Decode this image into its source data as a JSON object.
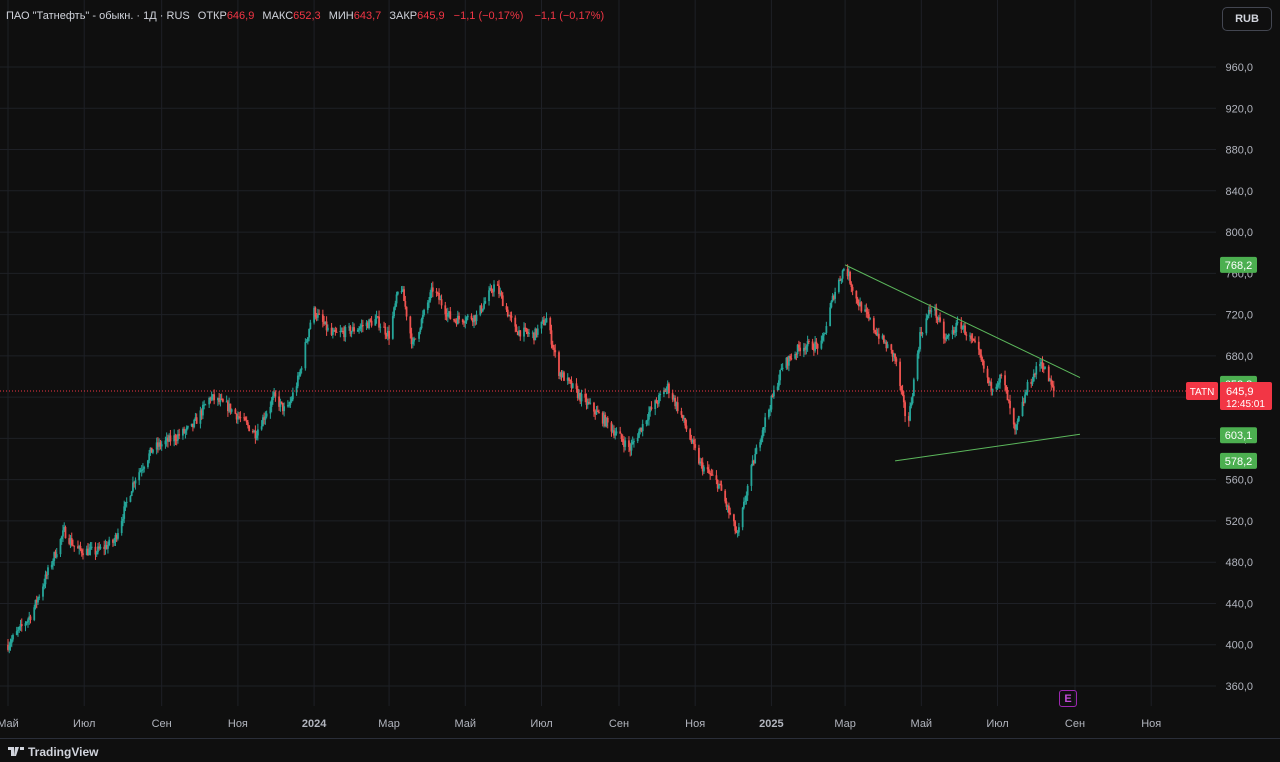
{
  "legend": {
    "title": "ПАО \"Татнефть\" - обыкн. · 1Д · RUS",
    "open_label": "ОТКР",
    "open_value": "646,9",
    "high_label": "МАКС",
    "high_value": "652,3",
    "low_label": "МИН",
    "low_value": "643,7",
    "close_label": "ЗАКР",
    "close_value": "645,9",
    "change": "−1,1 (−0,17%)",
    "change2": "−1,1 (−0,17%)"
  },
  "currency": "RUB",
  "branding": "TradingView",
  "earnings_icon": "E",
  "colors": {
    "background": "#0f0f0f",
    "up": "#26a69a",
    "down": "#ef5350",
    "trendline": "#5cb85c",
    "price_badge": "#f23645",
    "level_badge": "#4caf50",
    "grid": "#1e2026"
  },
  "chart_data": {
    "type": "candlestick",
    "symbol": "TATN",
    "y_ticks": [
      "360,0",
      "400,0",
      "440,0",
      "480,0",
      "520,0",
      "560,0",
      "600,0",
      "640,0",
      "680,0",
      "720,0",
      "760,0",
      "800,0",
      "840,0",
      "880,0",
      "920,0",
      "960,0"
    ],
    "x_ticks": [
      {
        "label": "Май",
        "date": "2023-05-01"
      },
      {
        "label": "Июл",
        "date": "2023-07-01"
      },
      {
        "label": "Сен",
        "date": "2023-09-01"
      },
      {
        "label": "Ноя",
        "date": "2023-11-01"
      },
      {
        "label": "2024",
        "date": "2024-01-01",
        "bold": true
      },
      {
        "label": "Мар",
        "date": "2024-03-01"
      },
      {
        "label": "Май",
        "date": "2024-05-01"
      },
      {
        "label": "Июл",
        "date": "2024-07-01"
      },
      {
        "label": "Сен",
        "date": "2024-09-01"
      },
      {
        "label": "Ноя",
        "date": "2024-11-01"
      },
      {
        "label": "2025",
        "date": "2025-01-01",
        "bold": true
      },
      {
        "label": "Мар",
        "date": "2025-03-01"
      },
      {
        "label": "Май",
        "date": "2025-05-01"
      },
      {
        "label": "Июл",
        "date": "2025-07-01"
      },
      {
        "label": "Сен",
        "date": "2025-09-01"
      },
      {
        "label": "Ноя",
        "date": "2025-11-01"
      }
    ],
    "price_path": [
      [
        "2023-05-01",
        400
      ],
      [
        "2023-05-20",
        430
      ],
      [
        "2023-06-05",
        480
      ],
      [
        "2023-06-15",
        510
      ],
      [
        "2023-06-25",
        492
      ],
      [
        "2023-07-10",
        490
      ],
      [
        "2023-07-25",
        500
      ],
      [
        "2023-08-10",
        560
      ],
      [
        "2023-08-25",
        590
      ],
      [
        "2023-09-10",
        600
      ],
      [
        "2023-09-25",
        610
      ],
      [
        "2023-10-10",
        640
      ],
      [
        "2023-10-25",
        630
      ],
      [
        "2023-11-15",
        605
      ],
      [
        "2023-11-30",
        640
      ],
      [
        "2023-12-10",
        625
      ],
      [
        "2023-12-20",
        660
      ],
      [
        "2023-12-31",
        725
      ],
      [
        "2024-01-15",
        700
      ],
      [
        "2024-02-01",
        705
      ],
      [
        "2024-02-20",
        715
      ],
      [
        "2024-03-01",
        700
      ],
      [
        "2024-03-10",
        752
      ],
      [
        "2024-03-20",
        690
      ],
      [
        "2024-04-05",
        745
      ],
      [
        "2024-04-20",
        715
      ],
      [
        "2024-05-10",
        718
      ],
      [
        "2024-05-25",
        750
      ],
      [
        "2024-06-10",
        705
      ],
      [
        "2024-06-25",
        700
      ],
      [
        "2024-07-05",
        716
      ],
      [
        "2024-07-15",
        665
      ],
      [
        "2024-08-01",
        640
      ],
      [
        "2024-08-20",
        618
      ],
      [
        "2024-09-10",
        590
      ],
      [
        "2024-09-25",
        625
      ],
      [
        "2024-10-10",
        650
      ],
      [
        "2024-10-20",
        625
      ],
      [
        "2024-11-05",
        575
      ],
      [
        "2024-11-20",
        555
      ],
      [
        "2024-12-05",
        505
      ],
      [
        "2024-12-15",
        565
      ],
      [
        "2024-12-25",
        610
      ],
      [
        "2025-01-10",
        670
      ],
      [
        "2025-01-25",
        690
      ],
      [
        "2025-02-10",
        690
      ],
      [
        "2025-02-20",
        740
      ],
      [
        "2025-03-01",
        768
      ],
      [
        "2025-03-10",
        735
      ],
      [
        "2025-03-25",
        705
      ],
      [
        "2025-04-10",
        678
      ],
      [
        "2025-04-20",
        610
      ],
      [
        "2025-04-30",
        700
      ],
      [
        "2025-05-10",
        730
      ],
      [
        "2025-05-20",
        695
      ],
      [
        "2025-06-01",
        712
      ],
      [
        "2025-06-15",
        685
      ],
      [
        "2025-06-25",
        650
      ],
      [
        "2025-07-05",
        660
      ],
      [
        "2025-07-15",
        605
      ],
      [
        "2025-07-25",
        650
      ],
      [
        "2025-08-05",
        675
      ],
      [
        "2025-08-15",
        645
      ]
    ],
    "trendlines": [
      {
        "from": [
          "2025-03-01",
          768.2
        ],
        "to": [
          "2025-09-05",
          659
        ]
      },
      {
        "from": [
          "2025-04-10",
          578.2
        ],
        "to": [
          "2025-09-05",
          604
        ]
      }
    ],
    "current_price_line": 645.9,
    "price_labels": [
      {
        "value": 768.2,
        "text": "768,2"
      },
      {
        "value": 652.8,
        "text": "652,8"
      },
      {
        "value": 603.1,
        "text": "603,1"
      },
      {
        "value": 578.2,
        "text": "578,2"
      }
    ],
    "current_price": {
      "ticker": "TATN",
      "price": "645,9",
      "countdown": "12:45:01"
    }
  }
}
